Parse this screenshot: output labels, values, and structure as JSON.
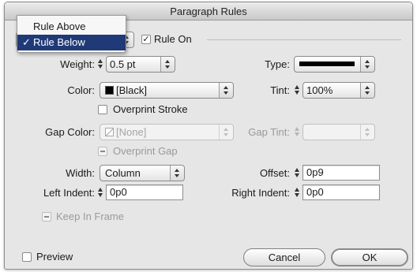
{
  "window": {
    "title": "Paragraph Rules"
  },
  "rule_menu": {
    "items": [
      {
        "label": "Rule Above",
        "checked": false
      },
      {
        "label": "Rule Below",
        "checked": true
      }
    ],
    "check_mark": "✓"
  },
  "rule_on": {
    "label": "Rule On",
    "checked": true
  },
  "weight": {
    "label": "Weight:",
    "value": "0.5 pt"
  },
  "type": {
    "label": "Type:"
  },
  "color": {
    "label": "Color:",
    "value": "[Black]",
    "swatch": "#000000"
  },
  "tint": {
    "label": "Tint:",
    "value": "100%"
  },
  "overprint_stroke": {
    "label": "Overprint Stroke"
  },
  "gap_color": {
    "label": "Gap Color:",
    "value": "[None]"
  },
  "gap_tint": {
    "label": "Gap Tint:",
    "value": ""
  },
  "overprint_gap": {
    "label": "Overprint Gap"
  },
  "width": {
    "label": "Width:",
    "value": "Column"
  },
  "offset": {
    "label": "Offset:",
    "value": "0p9"
  },
  "left_indent": {
    "label": "Left Indent:",
    "value": "0p0"
  },
  "right_indent": {
    "label": "Right Indent:",
    "value": "0p0"
  },
  "keep_in_frame": {
    "label": "Keep In Frame"
  },
  "preview": {
    "label": "Preview"
  },
  "buttons": {
    "cancel": "Cancel",
    "ok": "OK"
  },
  "colors": {
    "menu_highlight": "#203a78",
    "window_bg": "#e6e6e6"
  }
}
